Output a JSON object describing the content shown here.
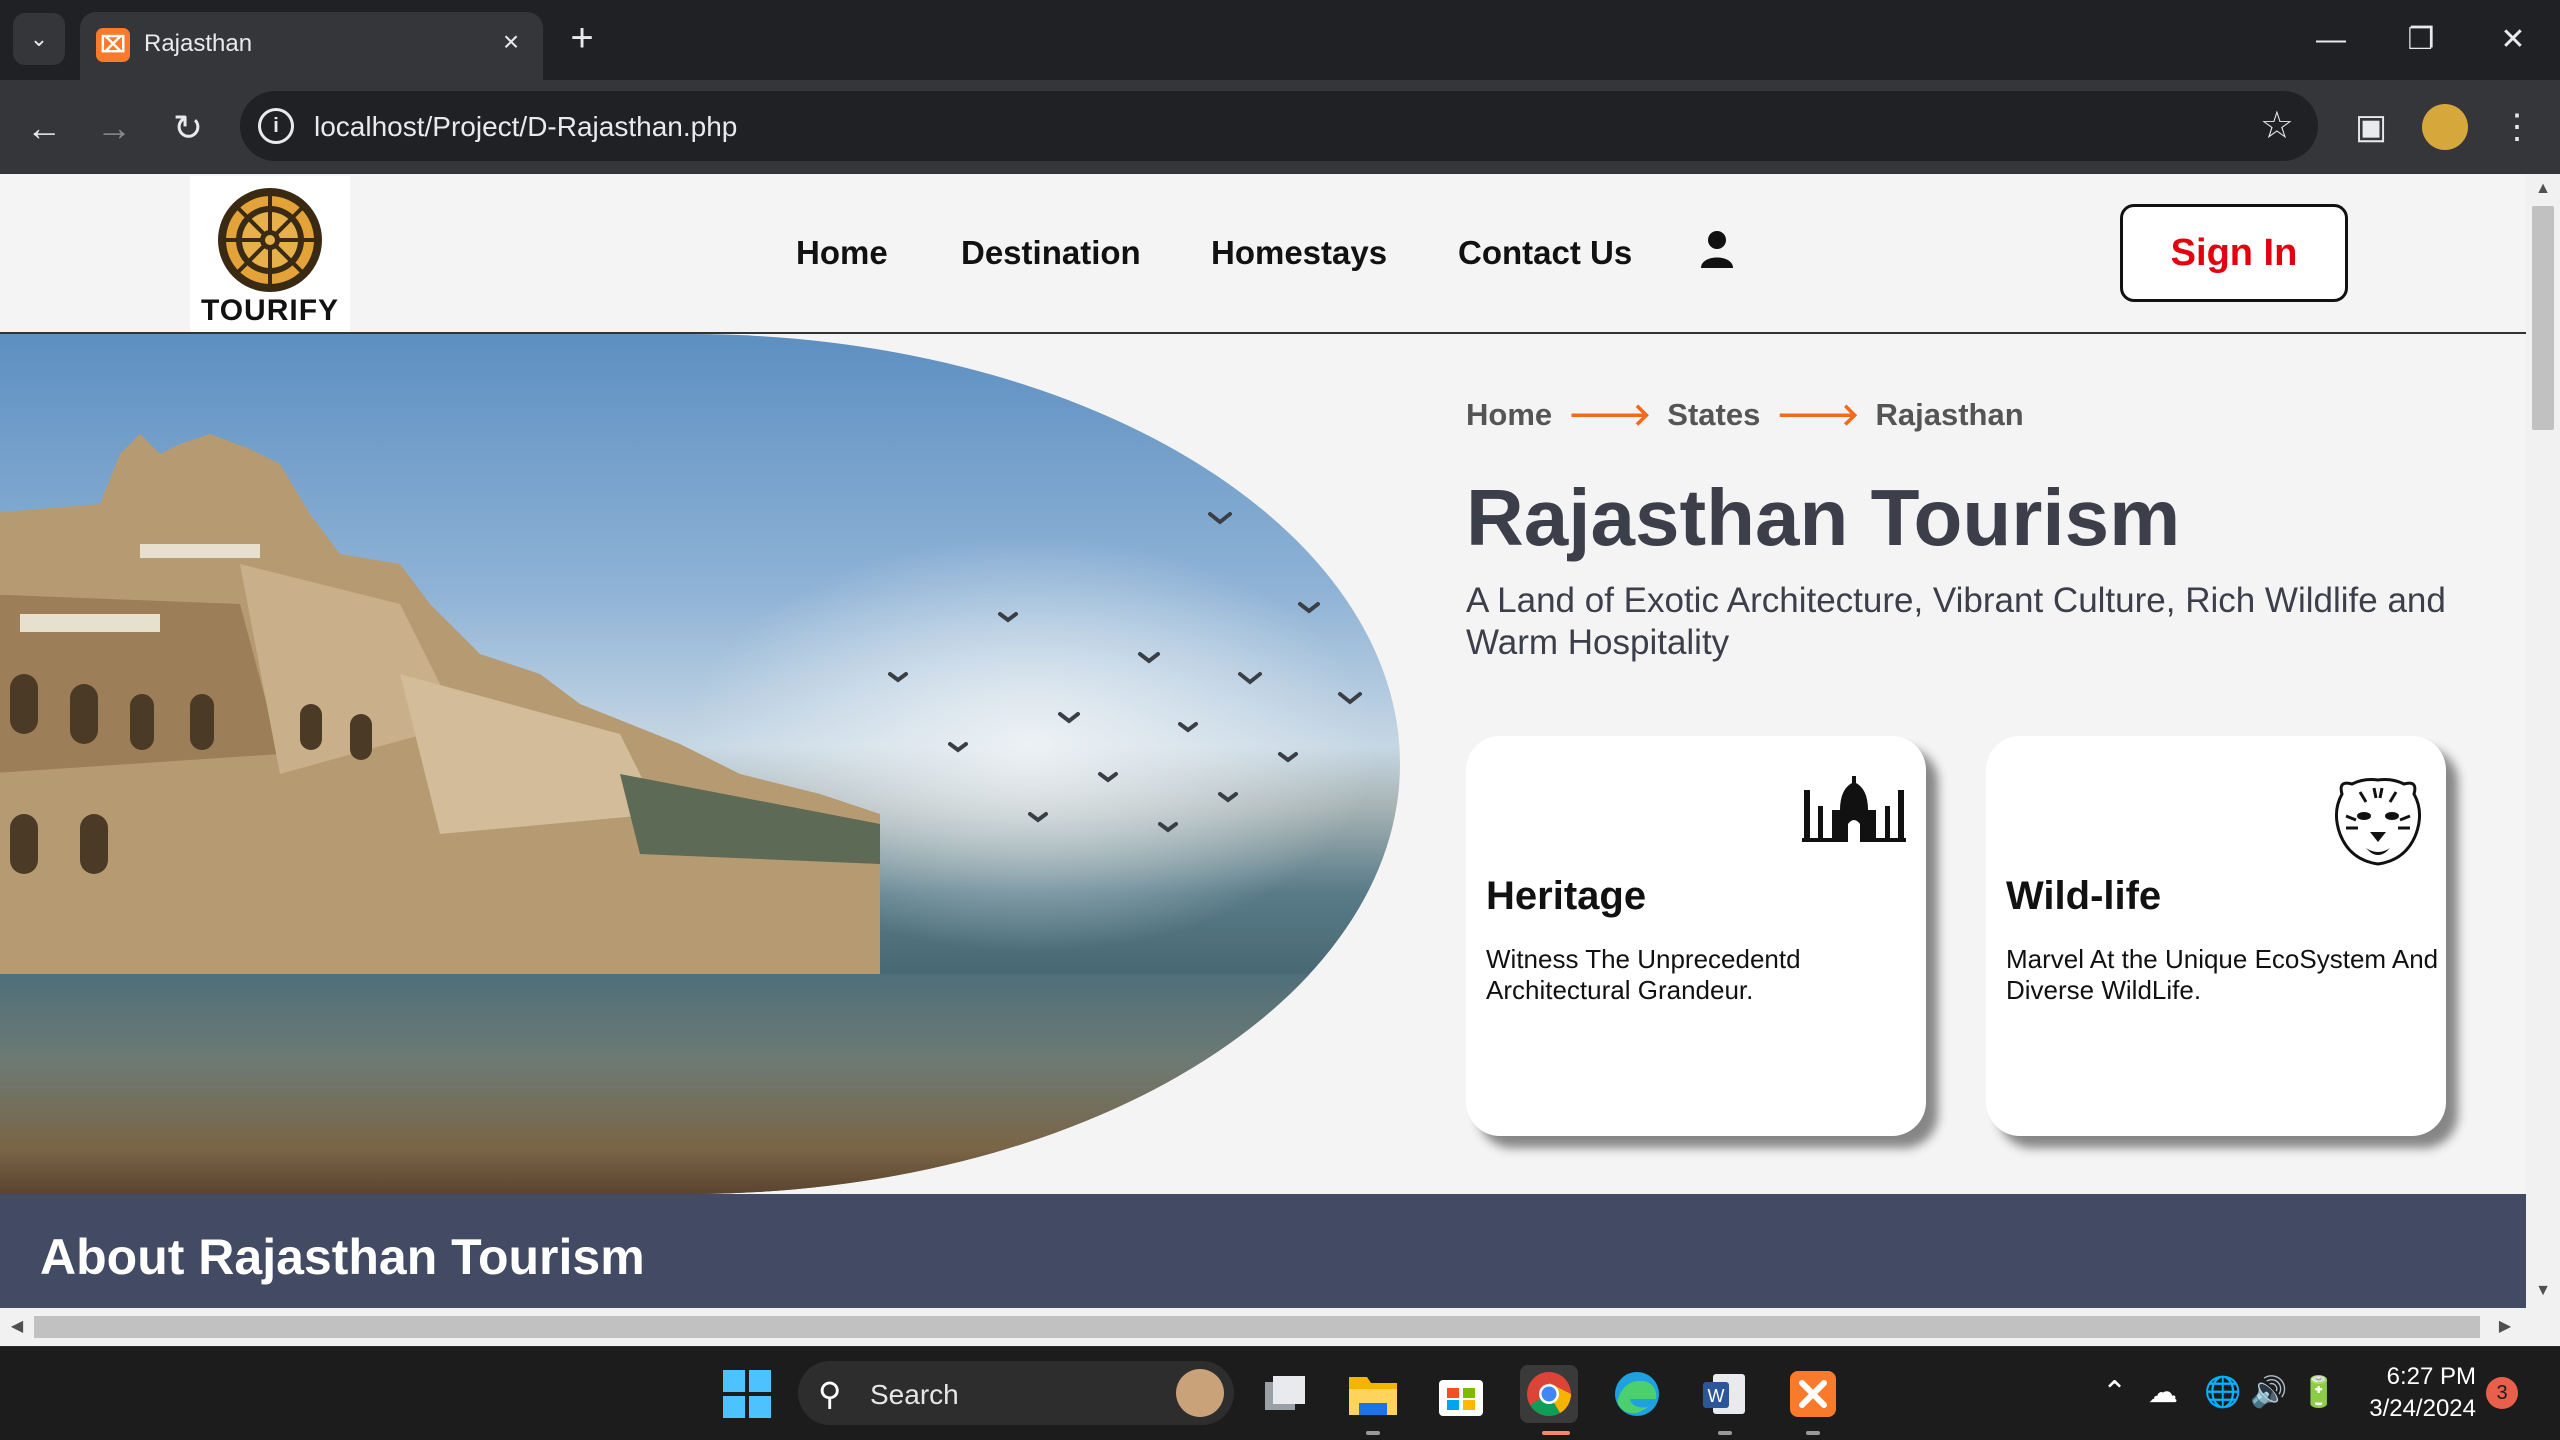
{
  "browser": {
    "tab_title": "Rajasthan",
    "tab_favicon": "XAMPP",
    "url": "localhost/Project/D-Rajasthan.php"
  },
  "site": {
    "logo_text": "TOURIFY",
    "nav": [
      "Home",
      "Destination",
      "Homestays",
      "Contact Us"
    ],
    "signin_label": "Sign In"
  },
  "hero": {
    "breadcrumb": [
      "Home",
      "States",
      "Rajasthan"
    ],
    "title": "Rajasthan Tourism",
    "subtitle": "A Land of Exotic Architecture, Vibrant Culture, Rich Wildlife and Warm Hospitality"
  },
  "cards": [
    {
      "title": "Heritage",
      "text": "Witness The Unprecedentd Architectural Grandeur.",
      "icon": "taj-mahal-icon"
    },
    {
      "title": "Wild-life",
      "text": "Marvel At the Unique EcoSystem And Diverse WildLife.",
      "icon": "tiger-icon"
    }
  ],
  "about": {
    "title": "About Rajasthan Tourism"
  },
  "taskbar": {
    "search_label": "Search",
    "time": "6:27 PM",
    "date": "3/24/2024",
    "notifications": "3"
  },
  "colors": {
    "accent_arrow": "#f26a1b",
    "signin_text": "#e3000f",
    "about_bg": "#434a63"
  }
}
